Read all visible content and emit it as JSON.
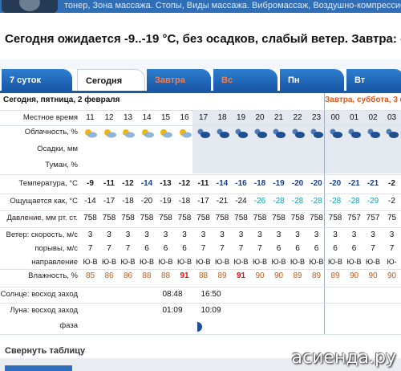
{
  "top_strip": {
    "text": "тонер, Зона массажа. Стопы, Виды массажа. Вибромассаж, Воздушно-компрессионный"
  },
  "headline": "Сегодня ожидается -9..-19 °C, без осадков, слабый ветер. Завтра: -19..-1",
  "tabs": [
    {
      "label": "7 суток",
      "active": false,
      "weekend": false
    },
    {
      "label": "Сегодня",
      "active": true,
      "weekend": false
    },
    {
      "label": "Завтра",
      "active": false,
      "weekend": true
    },
    {
      "label": "Вс",
      "active": false,
      "weekend": true
    },
    {
      "label": "Пн",
      "active": false,
      "weekend": false
    },
    {
      "label": "Вт",
      "active": false,
      "weekend": false
    }
  ],
  "day_today": "Сегодня, пятница, 2 февраля",
  "day_tomorrow": "Завтра, суббота, 3 ф",
  "labels": {
    "time": "Местное время",
    "cloud": "Облачность, %",
    "precip": "Осадки, мм",
    "fog": "Туман, %",
    "temp": "Температура, °C",
    "feels": "Ощущается как, °C",
    "pressure": "Давление, мм рт. ст.",
    "wind_speed": "Ветер: скорость, м/с",
    "gusts": "порывы, м/с",
    "direction": "направление",
    "humidity": "Влажность, %",
    "sun": "Солнце: восход заход",
    "moon": "Луна: восход заход",
    "phase": "фаза"
  },
  "hours": [
    "11",
    "12",
    "13",
    "14",
    "15",
    "16",
    "17",
    "18",
    "19",
    "20",
    "21",
    "22",
    "23",
    "00",
    "01",
    "02",
    "03"
  ],
  "cloud_icons": [
    "sun-cloud-icon",
    "sun-cloud-icon",
    "sun-cloud-icon",
    "sun-cloud-icon",
    "sun-cloud-icon",
    "sun-cloud-icon",
    "moon-cloud-icon",
    "moon-cloud-icon",
    "moon-cloud-icon",
    "moon-cloud-icon",
    "moon-cloud-icon",
    "moon-cloud-icon",
    "moon-cloud-icon",
    "moon-cloud-icon",
    "moon-cloud-icon",
    "moon-cloud-icon",
    "moon-cloud-icon"
  ],
  "temperature": [
    "-9",
    "-11",
    "-12",
    "-14",
    "-13",
    "-12",
    "-11",
    "-14",
    "-16",
    "-18",
    "-19",
    "-20",
    "-20",
    "-20",
    "-21",
    "-21",
    "-2"
  ],
  "feels_like": [
    "-14",
    "-17",
    "-18",
    "-20",
    "-19",
    "-18",
    "-17",
    "-21",
    "-24",
    "-26",
    "-28",
    "-28",
    "-28",
    "-28",
    "-28",
    "-29",
    "-2"
  ],
  "pressure": [
    "758",
    "758",
    "758",
    "758",
    "758",
    "758",
    "758",
    "758",
    "758",
    "758",
    "758",
    "758",
    "758",
    "758",
    "757",
    "757",
    "75"
  ],
  "wind_speed": [
    "3",
    "3",
    "3",
    "3",
    "3",
    "3",
    "3",
    "3",
    "3",
    "3",
    "3",
    "3",
    "3",
    "3",
    "3",
    "3",
    "3"
  ],
  "gusts": [
    "7",
    "7",
    "7",
    "6",
    "6",
    "6",
    "7",
    "7",
    "7",
    "7",
    "6",
    "6",
    "6",
    "6",
    "6",
    "7",
    "7"
  ],
  "direction": [
    "Ю-В",
    "Ю-В",
    "Ю-В",
    "Ю-В",
    "Ю-В",
    "Ю-В",
    "Ю-В",
    "Ю-В",
    "Ю-В",
    "Ю-В",
    "Ю-В",
    "Ю-В",
    "Ю-В",
    "Ю-В",
    "Ю-В",
    "Ю-В",
    "Ю-"
  ],
  "humidity": [
    "85",
    "86",
    "86",
    "88",
    "88",
    "91",
    "88",
    "89",
    "91",
    "90",
    "90",
    "89",
    "89",
    "89",
    "90",
    "90",
    "90"
  ],
  "sun": {
    "rise": "08:48",
    "set": "16:50"
  },
  "moon": {
    "rise": "01:09",
    "set": "10:09"
  },
  "collapse": "Свернуть таблицу",
  "brand": "асиенда.ру",
  "colors": {
    "tab_blue": "#1655a4",
    "weekend": "#ff7a3d",
    "humidity": "#c85b18",
    "feels_cold": "#0fa2b5"
  }
}
